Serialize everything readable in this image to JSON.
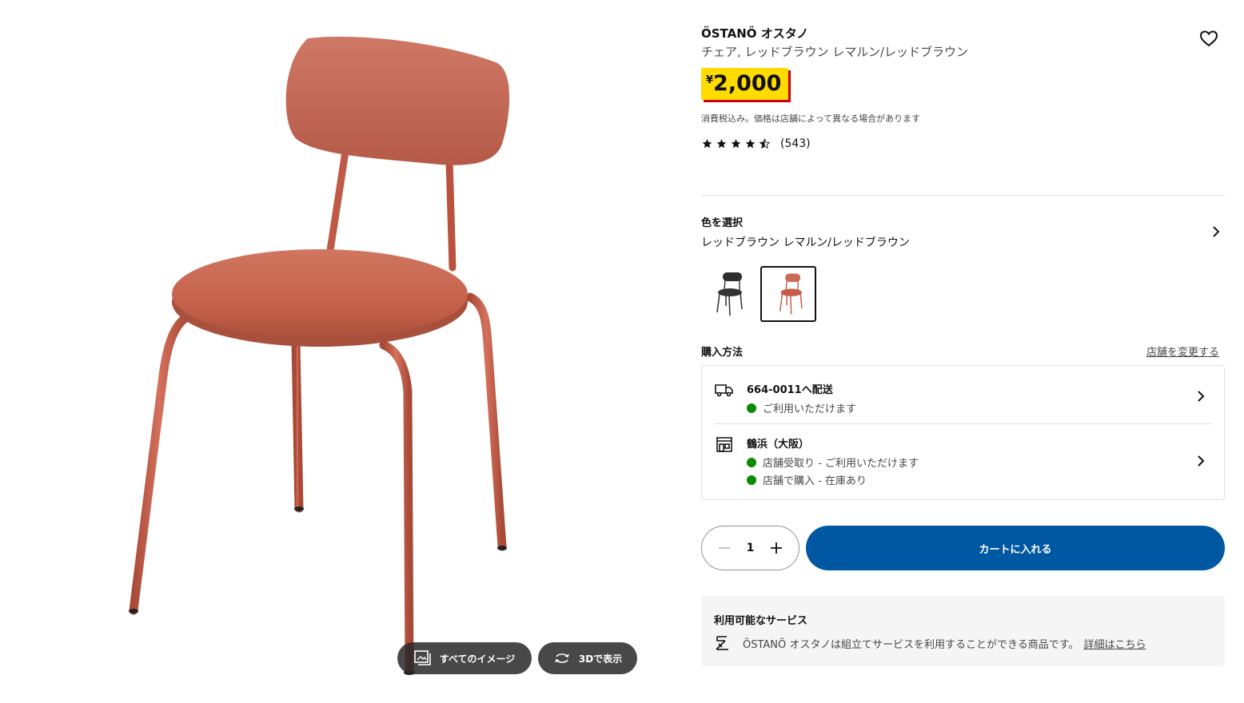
{
  "gallery": {
    "all_images_label": "すべてのイメージ",
    "view_3d_label": "3Dで表示"
  },
  "product": {
    "name": "ÖSTANÖ オスタノ",
    "description": "チェア, レッドブラウン レマルン/レッドブラウン",
    "price_currency": "¥",
    "price_value": "2,000",
    "tax_note": "消費税込み。価格は店舗によって異なる場合があります",
    "rating": 4.5,
    "review_count": "(543)"
  },
  "color": {
    "title": "色を選択",
    "selected_value": "レッドブラウン レマルン/レッドブラウン",
    "swatches": [
      "black",
      "red-brown"
    ],
    "selected_index": 1
  },
  "purchase": {
    "title": "購入方法",
    "change_store_label": "店舗を変更する",
    "delivery": {
      "title": "664-0011へ配送",
      "status": "ご利用いただけます"
    },
    "store": {
      "title": "鶴浜（大阪）",
      "pickup_status": "店舗受取り - ご利用いただけます",
      "instore_status": "店舗で購入 - 在庫あり"
    }
  },
  "cart": {
    "quantity": "1",
    "add_label": "カートに入れる"
  },
  "services": {
    "title": "利用可能なサービス",
    "text": "ÖSTANÖ オスタノは組立てサービスを利用することができる商品です。",
    "link_label": "詳細はこちら"
  },
  "colors": {
    "accent_blue": "#0058a3",
    "price_yellow": "#ffdb00",
    "price_red": "#cc0008",
    "available_green": "#0a8a00",
    "chair_fabric": "#c96a55",
    "chair_metal": "#c8604a"
  }
}
